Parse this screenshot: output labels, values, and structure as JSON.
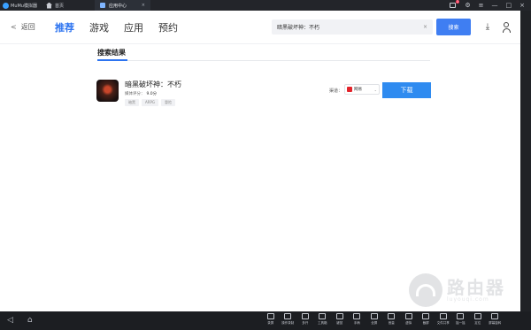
{
  "titlebar": {
    "app_name": "MuMu模拟器",
    "home_tab": "首页",
    "active_tab": "应用中心",
    "tab_close": "×",
    "notification_count": "2",
    "controls": [
      "⚙",
      "≡",
      "—",
      "□",
      "×"
    ]
  },
  "nav": {
    "back_label": "返回",
    "tabs": [
      {
        "label": "推荐",
        "active": true
      },
      {
        "label": "游戏",
        "active": false
      },
      {
        "label": "应用",
        "active": false
      },
      {
        "label": "预约",
        "active": false
      }
    ],
    "search_value": "暗黑破坏神：不朽",
    "search_clear": "×",
    "search_button": "搜索"
  },
  "results": {
    "title": "搜索结果",
    "items": [
      {
        "name": "暗黑破坏神：不朽",
        "rating_label": "媒体评分：",
        "rating_value": "9.0分",
        "tags": [
          "暗黑",
          "ARPG",
          "冒险"
        ],
        "source_label": "渠道：",
        "source_value": "网易",
        "download_label": "下载"
      }
    ]
  },
  "watermark": {
    "text": "路由器",
    "url": "luyouqi.com"
  },
  "bottombar": {
    "tools": [
      "录屏",
      "操作录制",
      "多开",
      "工具箱",
      "键鼠",
      "手柄",
      "全屏",
      "音量",
      "虚拟",
      "截屏",
      "文件共享",
      "摇一摇",
      "定位",
      "屏幕旋转"
    ]
  },
  "colors": {
    "accent": "#2d74f0",
    "download_button": "#2f8bf0",
    "search_button": "#3f7ef2",
    "titlebar": "#23252a",
    "bottombar": "#1c1e22"
  }
}
